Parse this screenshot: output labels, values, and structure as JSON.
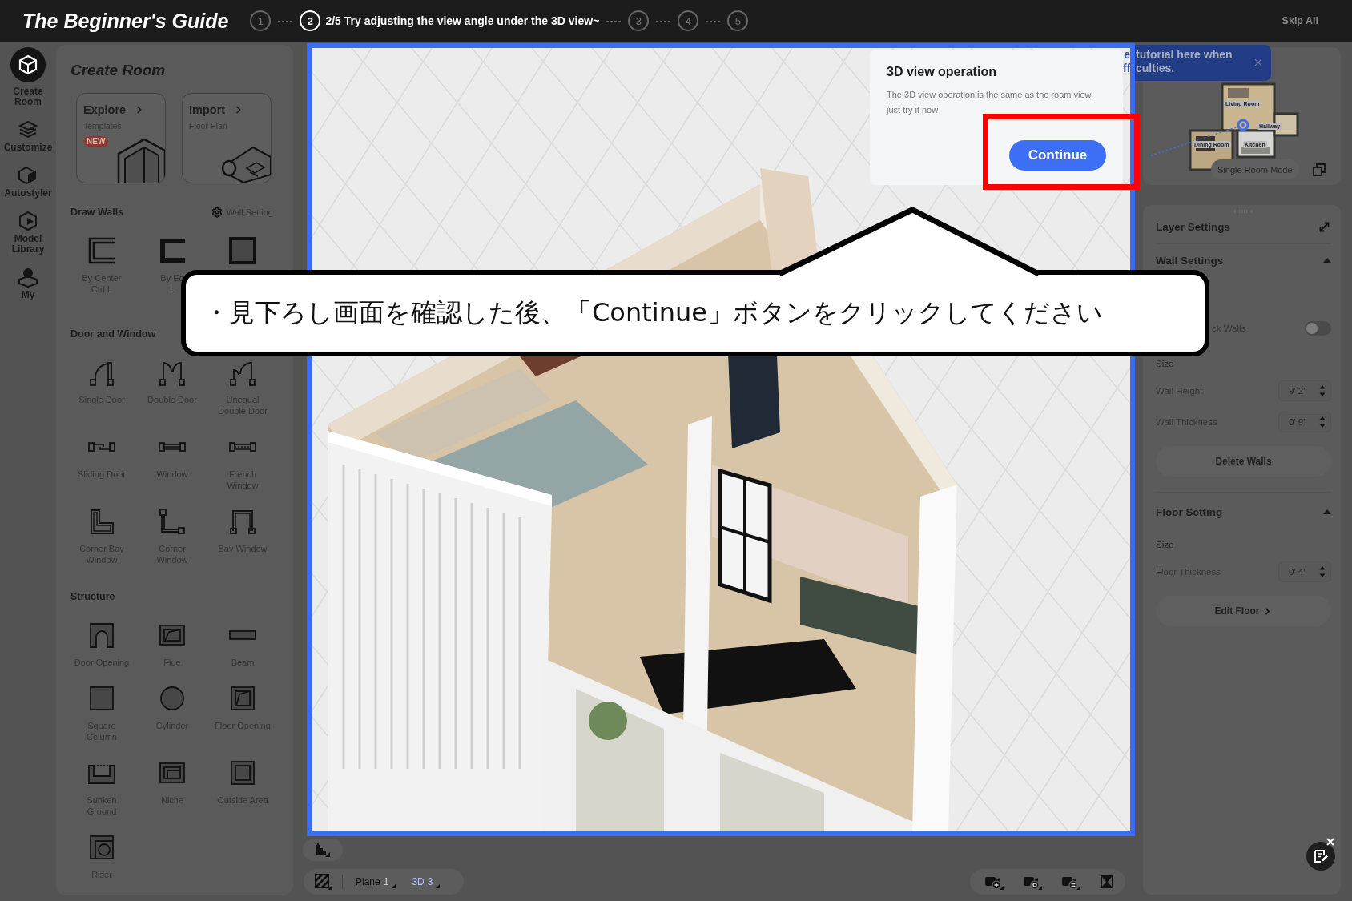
{
  "guide_bar": {
    "title": "The Beginner's Guide",
    "steps": [
      {
        "number": "1",
        "selected": false
      },
      {
        "number": "2",
        "selected": true,
        "caption": "2/5 Try adjusting the view angle under the 3D view~"
      },
      {
        "number": "3",
        "selected": false
      },
      {
        "number": "4",
        "selected": false
      },
      {
        "number": "5",
        "selected": false
      }
    ],
    "skip_button": "Skip All"
  },
  "nav_rail": [
    {
      "label": "Create\nRoom",
      "selected": true
    },
    {
      "label": "Customize",
      "selected": false
    },
    {
      "label": "Autostyler",
      "selected": false
    },
    {
      "label": "Model\nLibrary",
      "selected": false
    },
    {
      "label": "My",
      "selected": false
    }
  ],
  "create_panel": {
    "title": "Create Room",
    "cards": [
      {
        "title": "Explore",
        "subtitle": "Templates",
        "badge": "NEW"
      },
      {
        "title": "Import",
        "subtitle": "Floor Plan"
      }
    ],
    "sections": [
      {
        "title": "Draw Walls",
        "action": "Wall Setting",
        "tools": [
          {
            "kind": "center",
            "label": "By Center",
            "shortcut": "Ctrl L"
          },
          {
            "kind": "edge",
            "label": "By Ed",
            "shortcut": "L"
          },
          {
            "kind": "room"
          }
        ]
      },
      {
        "title": "Door and Window",
        "tools": [
          {
            "kind": "door",
            "label": "Single Door"
          },
          {
            "kind": "double",
            "label": "Double Door"
          },
          {
            "kind": "unequal",
            "label": "Unequal\nDouble Door"
          },
          {
            "kind": "sliding",
            "label": "Sliding Door"
          },
          {
            "kind": "window",
            "label": "Window"
          },
          {
            "kind": "french",
            "label": "French\nWindow"
          },
          {
            "kind": "cornerbay",
            "label": "Corner Bay\nWindow"
          },
          {
            "kind": "corner",
            "label": "Corner\nWindow"
          },
          {
            "kind": "bay",
            "label": "Bay Window"
          }
        ]
      },
      {
        "title": "Structure",
        "tools": [
          {
            "kind": "opening",
            "label": "Door Opening"
          },
          {
            "kind": "flue",
            "label": "Flue"
          },
          {
            "kind": "beam",
            "label": "Beam"
          },
          {
            "kind": "column",
            "label": "Square\nColumn"
          },
          {
            "kind": "cylinder",
            "label": "Cylinder"
          },
          {
            "kind": "hole",
            "label": "Floor Opening"
          },
          {
            "kind": "sunken",
            "label": "Sunken\nGround"
          },
          {
            "kind": "niche",
            "label": "Niche"
          },
          {
            "kind": "outside",
            "label": "Outside Area"
          },
          {
            "kind": "riser",
            "label": "Riser"
          }
        ]
      }
    ]
  },
  "popup": {
    "title": "3D view operation",
    "body": "The 3D view operation is the same as the roam view, just try it now",
    "button": "Continue"
  },
  "callout": {
    "text": "・見下ろし画面を確認した後、「Continue」ボタンをクリックしてください"
  },
  "tooltip": {
    "lines": [
      {
        "cut": "e",
        "text": "tutorial here when"
      },
      {
        "cut": "ff",
        "text": "culties."
      }
    ]
  },
  "minimap": {
    "rooms": [
      {
        "label": "Living Room"
      },
      {
        "label": "Hallway"
      },
      {
        "label": "Dining Room"
      },
      {
        "label": "Kitchen"
      }
    ],
    "mode_button": "Single Room Mode"
  },
  "layer_settings": {
    "title": "Layer Settings",
    "groups": [
      {
        "title": "Wall Settings",
        "expanded": true,
        "toggle": {
          "label": "ck Walls",
          "on": false
        },
        "size_label": "Size",
        "fields": [
          {
            "label": "Wall Height",
            "value": "9' 2\""
          },
          {
            "label": "Wall Thickness",
            "value": "0' 9\""
          }
        ],
        "button": "Delete Walls"
      },
      {
        "title": "Floor Setting",
        "expanded": true,
        "size_label": "Size",
        "fields": [
          {
            "label": "Floor Thickness",
            "value": "0' 4\""
          }
        ],
        "button": "Edit Floor"
      }
    ]
  },
  "view_bar": {
    "tabs": [
      {
        "label": "Plane",
        "count": "1",
        "selected": false
      },
      {
        "label": "3D",
        "count": "3",
        "selected": true
      }
    ]
  }
}
